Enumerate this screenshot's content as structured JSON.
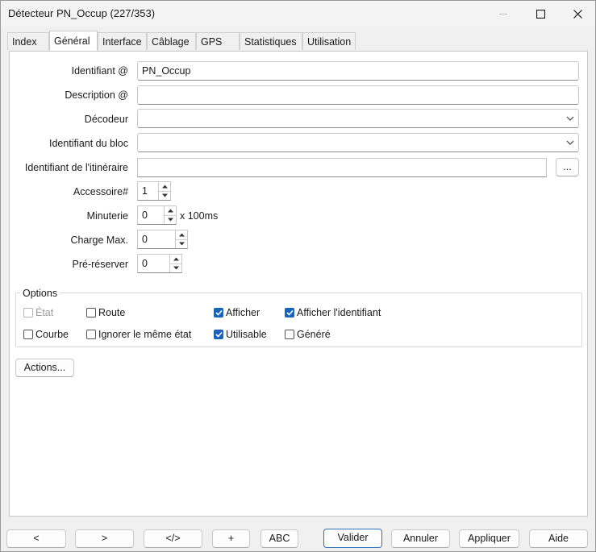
{
  "window": {
    "title": "Détecteur PN_Occup (227/353)"
  },
  "tabs": [
    {
      "label": "Index",
      "active": false
    },
    {
      "label": "Général",
      "active": true
    },
    {
      "label": "Interface",
      "active": false
    },
    {
      "label": "Câblage",
      "active": false
    },
    {
      "label": "GPS",
      "active": false
    },
    {
      "label": "Statistiques",
      "active": false
    },
    {
      "label": "Utilisation",
      "active": false
    }
  ],
  "form": {
    "identifiant_label": "Identifiant @",
    "identifiant_value": "PN_Occup",
    "description_label": "Description @",
    "description_value": "",
    "decodeur_label": "Décodeur",
    "decodeur_value": "",
    "bloc_label": "Identifiant du bloc",
    "bloc_value": "",
    "itineraire_label": "Identifiant de l'itinéraire",
    "itineraire_value": "",
    "browse_label": "...",
    "accessoire_label": "Accessoire#",
    "accessoire_value": "1",
    "minuterie_label": "Minuterie",
    "minuterie_value": "0",
    "minuterie_unit": "x 100ms",
    "charge_label": "Charge Max.",
    "charge_value": "0",
    "prereserver_label": "Pré-réserver",
    "prereserver_value": "0"
  },
  "options": {
    "title": "Options",
    "items": [
      {
        "label": "État",
        "checked": false,
        "disabled": true
      },
      {
        "label": "Route",
        "checked": false,
        "disabled": false
      },
      {
        "label": "Afficher",
        "checked": true,
        "disabled": false
      },
      {
        "label": "Afficher l'identifiant",
        "checked": true,
        "disabled": false
      },
      {
        "label": "Courbe",
        "checked": false,
        "disabled": false
      },
      {
        "label": "Ignorer le même état",
        "checked": false,
        "disabled": false
      },
      {
        "label": "Utilisable",
        "checked": true,
        "disabled": false
      },
      {
        "label": "Généré",
        "checked": false,
        "disabled": false
      }
    ]
  },
  "actions_label": "Actions...",
  "footer": {
    "prev": "<",
    "next": ">",
    "xml": "</>",
    "add": "+",
    "abc": "ABC",
    "valider": "Valider",
    "annuler": "Annuler",
    "appliquer": "Appliquer",
    "aide": "Aide"
  },
  "colors": {
    "accent": "#1a63b8",
    "primary_border": "#2f6fbf"
  }
}
